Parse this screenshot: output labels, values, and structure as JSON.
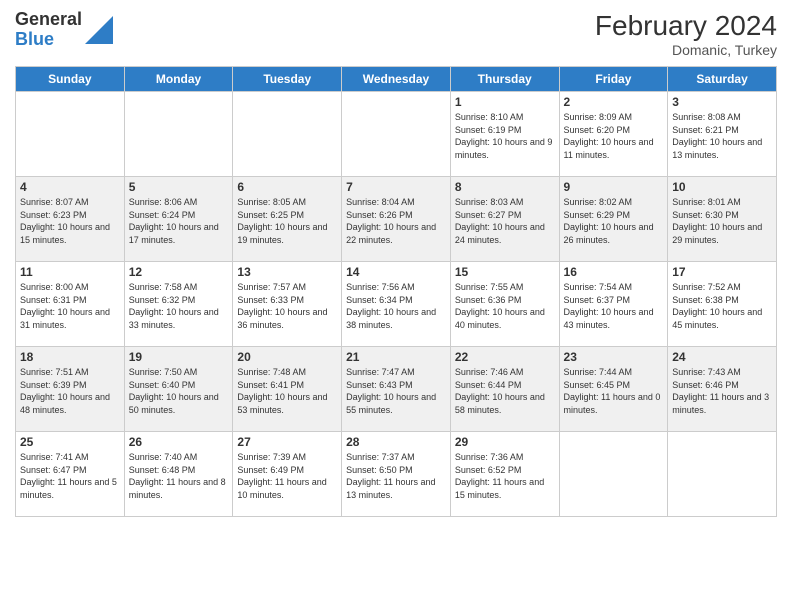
{
  "header": {
    "logo_general": "General",
    "logo_blue": "Blue",
    "month_year": "February 2024",
    "location": "Domanic, Turkey"
  },
  "weekdays": [
    "Sunday",
    "Monday",
    "Tuesday",
    "Wednesday",
    "Thursday",
    "Friday",
    "Saturday"
  ],
  "weeks": [
    [
      {
        "day": "",
        "info": ""
      },
      {
        "day": "",
        "info": ""
      },
      {
        "day": "",
        "info": ""
      },
      {
        "day": "",
        "info": ""
      },
      {
        "day": "1",
        "info": "Sunrise: 8:10 AM\nSunset: 6:19 PM\nDaylight: 10 hours and 9 minutes."
      },
      {
        "day": "2",
        "info": "Sunrise: 8:09 AM\nSunset: 6:20 PM\nDaylight: 10 hours and 11 minutes."
      },
      {
        "day": "3",
        "info": "Sunrise: 8:08 AM\nSunset: 6:21 PM\nDaylight: 10 hours and 13 minutes."
      }
    ],
    [
      {
        "day": "4",
        "info": "Sunrise: 8:07 AM\nSunset: 6:23 PM\nDaylight: 10 hours and 15 minutes."
      },
      {
        "day": "5",
        "info": "Sunrise: 8:06 AM\nSunset: 6:24 PM\nDaylight: 10 hours and 17 minutes."
      },
      {
        "day": "6",
        "info": "Sunrise: 8:05 AM\nSunset: 6:25 PM\nDaylight: 10 hours and 19 minutes."
      },
      {
        "day": "7",
        "info": "Sunrise: 8:04 AM\nSunset: 6:26 PM\nDaylight: 10 hours and 22 minutes."
      },
      {
        "day": "8",
        "info": "Sunrise: 8:03 AM\nSunset: 6:27 PM\nDaylight: 10 hours and 24 minutes."
      },
      {
        "day": "9",
        "info": "Sunrise: 8:02 AM\nSunset: 6:29 PM\nDaylight: 10 hours and 26 minutes."
      },
      {
        "day": "10",
        "info": "Sunrise: 8:01 AM\nSunset: 6:30 PM\nDaylight: 10 hours and 29 minutes."
      }
    ],
    [
      {
        "day": "11",
        "info": "Sunrise: 8:00 AM\nSunset: 6:31 PM\nDaylight: 10 hours and 31 minutes."
      },
      {
        "day": "12",
        "info": "Sunrise: 7:58 AM\nSunset: 6:32 PM\nDaylight: 10 hours and 33 minutes."
      },
      {
        "day": "13",
        "info": "Sunrise: 7:57 AM\nSunset: 6:33 PM\nDaylight: 10 hours and 36 minutes."
      },
      {
        "day": "14",
        "info": "Sunrise: 7:56 AM\nSunset: 6:34 PM\nDaylight: 10 hours and 38 minutes."
      },
      {
        "day": "15",
        "info": "Sunrise: 7:55 AM\nSunset: 6:36 PM\nDaylight: 10 hours and 40 minutes."
      },
      {
        "day": "16",
        "info": "Sunrise: 7:54 AM\nSunset: 6:37 PM\nDaylight: 10 hours and 43 minutes."
      },
      {
        "day": "17",
        "info": "Sunrise: 7:52 AM\nSunset: 6:38 PM\nDaylight: 10 hours and 45 minutes."
      }
    ],
    [
      {
        "day": "18",
        "info": "Sunrise: 7:51 AM\nSunset: 6:39 PM\nDaylight: 10 hours and 48 minutes."
      },
      {
        "day": "19",
        "info": "Sunrise: 7:50 AM\nSunset: 6:40 PM\nDaylight: 10 hours and 50 minutes."
      },
      {
        "day": "20",
        "info": "Sunrise: 7:48 AM\nSunset: 6:41 PM\nDaylight: 10 hours and 53 minutes."
      },
      {
        "day": "21",
        "info": "Sunrise: 7:47 AM\nSunset: 6:43 PM\nDaylight: 10 hours and 55 minutes."
      },
      {
        "day": "22",
        "info": "Sunrise: 7:46 AM\nSunset: 6:44 PM\nDaylight: 10 hours and 58 minutes."
      },
      {
        "day": "23",
        "info": "Sunrise: 7:44 AM\nSunset: 6:45 PM\nDaylight: 11 hours and 0 minutes."
      },
      {
        "day": "24",
        "info": "Sunrise: 7:43 AM\nSunset: 6:46 PM\nDaylight: 11 hours and 3 minutes."
      }
    ],
    [
      {
        "day": "25",
        "info": "Sunrise: 7:41 AM\nSunset: 6:47 PM\nDaylight: 11 hours and 5 minutes."
      },
      {
        "day": "26",
        "info": "Sunrise: 7:40 AM\nSunset: 6:48 PM\nDaylight: 11 hours and 8 minutes."
      },
      {
        "day": "27",
        "info": "Sunrise: 7:39 AM\nSunset: 6:49 PM\nDaylight: 11 hours and 10 minutes."
      },
      {
        "day": "28",
        "info": "Sunrise: 7:37 AM\nSunset: 6:50 PM\nDaylight: 11 hours and 13 minutes."
      },
      {
        "day": "29",
        "info": "Sunrise: 7:36 AM\nSunset: 6:52 PM\nDaylight: 11 hours and 15 minutes."
      },
      {
        "day": "",
        "info": ""
      },
      {
        "day": "",
        "info": ""
      }
    ]
  ]
}
